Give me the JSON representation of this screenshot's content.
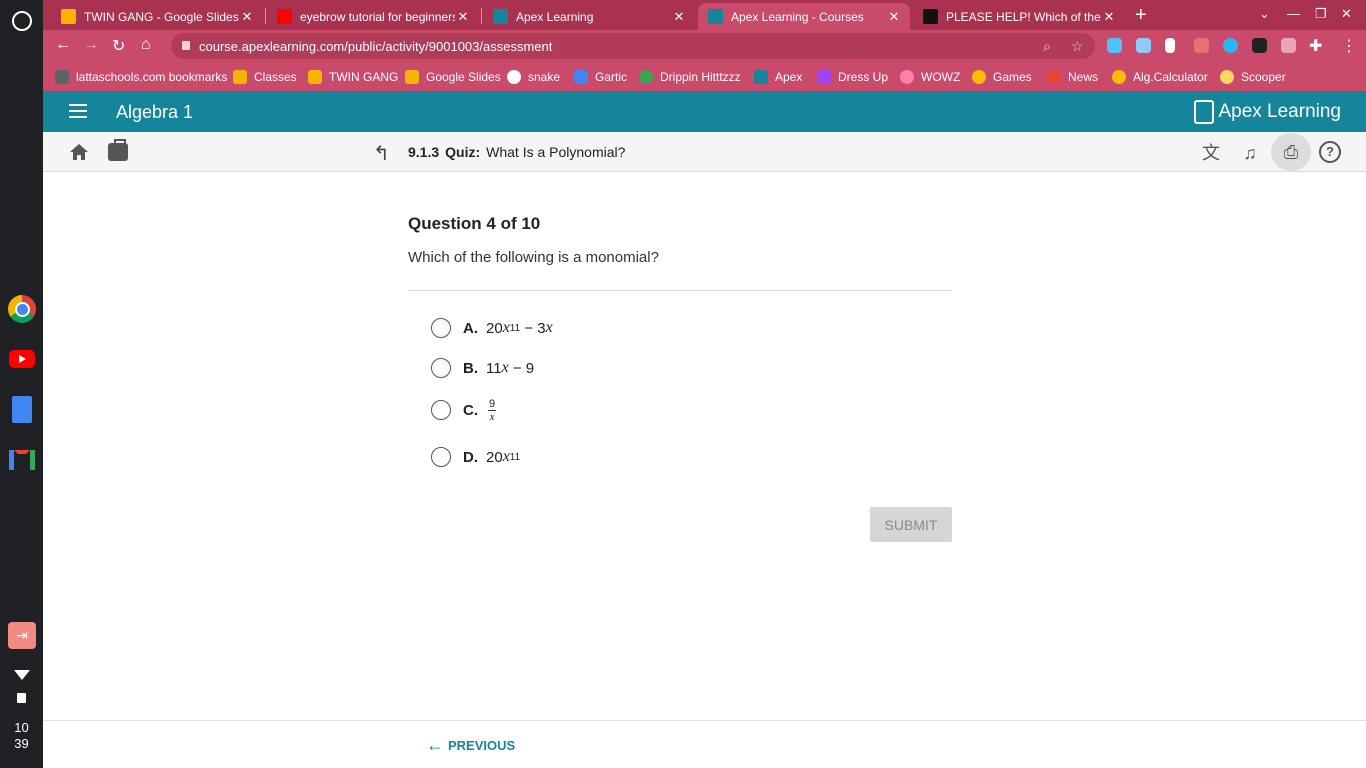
{
  "shelf": {
    "clock_hour": "10",
    "clock_minute": "39"
  },
  "tabs": [
    {
      "title": "TWIN GANG - Google Slides",
      "color": "#f4b400"
    },
    {
      "title": "eyebrow tutorial for beginners - Y",
      "color": "#ff0000"
    },
    {
      "title": "Apex Learning",
      "color": "#14859a"
    },
    {
      "title": "Apex Learning - Courses",
      "color": "#14859a"
    },
    {
      "title": "PLEASE HELP! Which of the follo",
      "color": "#111111"
    }
  ],
  "toolbar": {
    "url": "course.apexlearning.com/public/activity/9001003/assessment"
  },
  "bookmarks": [
    {
      "label": "lattaschools.com bookmarks",
      "color": "#5f6368"
    },
    {
      "label": "Classes",
      "color": "#f4b400"
    },
    {
      "label": "TWIN GANG",
      "color": "#f4b400"
    },
    {
      "label": "Google Slides",
      "color": "#f4b400"
    },
    {
      "label": "snake",
      "color": "#ffffff"
    },
    {
      "label": "Gartic",
      "color": "#4285f4"
    },
    {
      "label": "Drippin Hitttzzz",
      "color": "#34a853"
    },
    {
      "label": "Apex",
      "color": "#14859a"
    },
    {
      "label": "Dress Up",
      "color": "#a142f4"
    },
    {
      "label": "WOWZ",
      "color": "#ff80ab"
    },
    {
      "label": "Games",
      "color": "#fbbc04"
    },
    {
      "label": "News",
      "color": "#ea4335"
    },
    {
      "label": "Alg.Calculator",
      "color": "#fbbc04"
    },
    {
      "label": "Scooper",
      "color": "#fdd663"
    }
  ],
  "apex": {
    "course_title": "Algebra 1",
    "logo_text": "Apex Learning",
    "activity_number": "9.1.3",
    "activity_type": "Quiz:",
    "activity_title": "What Is a Polynomial?"
  },
  "question": {
    "heading": "Question 4 of 10",
    "prompt": "Which of the following is a monomial?",
    "choices": [
      {
        "letter": "A.",
        "coef": "20",
        "var": "x",
        "exp": "11",
        "rest": " − 3",
        "var2": "x"
      },
      {
        "letter": "B.",
        "coef": "11",
        "var": "x",
        "rest": " − 9"
      },
      {
        "letter": "C.",
        "numerator": "9",
        "denominator": "x"
      },
      {
        "letter": "D.",
        "coef": "20",
        "var": "x",
        "exp": "11"
      }
    ],
    "submit_label": "SUBMIT"
  },
  "footer": {
    "previous_label": "PREVIOUS"
  }
}
